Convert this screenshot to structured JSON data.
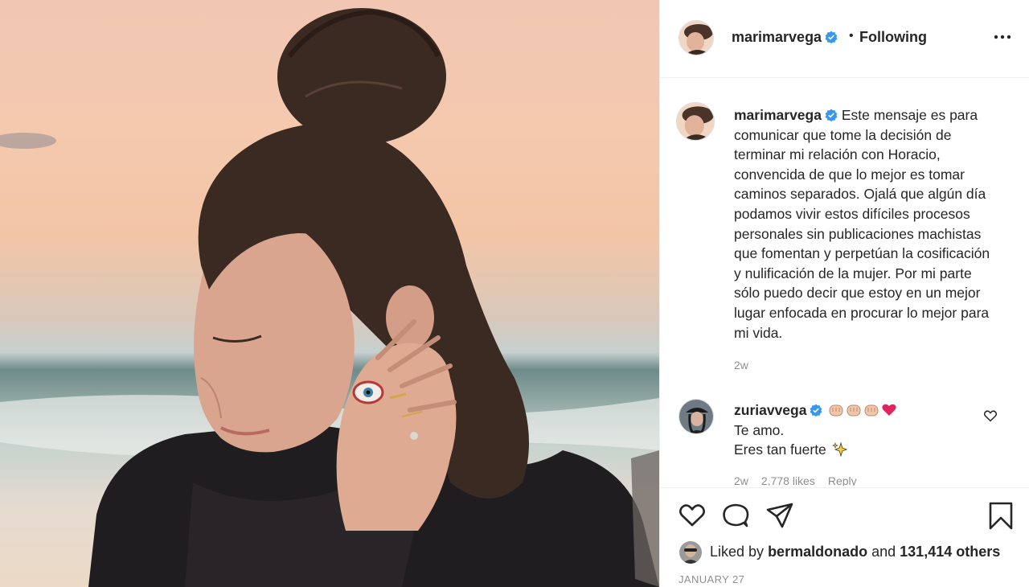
{
  "header": {
    "username": "marimarvega",
    "separator": "•",
    "follow_status": "Following"
  },
  "caption": {
    "username": "marimarvega",
    "text": "Este mensaje es para comunicar que tome la decisión de terminar mi relación con Horacio, convencida de que lo mejor es tomar caminos separados. Ojalá que algún día podamos vivir estos difíciles procesos personales sin publicaciones machistas que fomentan y perpetúan la cosificación y nulificación de la mujer. Por mi parte sólo puedo decir que estoy en un mejor lugar enfocada en procurar lo mejor para mi vida.",
    "time": "2w"
  },
  "comment": {
    "username": "zuriavvega",
    "line1": "Te amo.",
    "line2": "Eres tan fuerte",
    "time": "2w",
    "likes": "2,778 likes",
    "reply": "Reply"
  },
  "likes": {
    "prefix": "Liked by",
    "user": "bermaldonado",
    "mid": "and",
    "count": "131,414 others"
  },
  "date": "JANUARY 27",
  "icons": [
    "verified-badge",
    "more-icon",
    "heart-icon",
    "comment-icon",
    "share-icon",
    "bookmark-icon"
  ],
  "colors": {
    "verified": "#3897f0",
    "heart_emoji": "#e0245e",
    "muted": "#8e8e8e",
    "text": "#262626"
  }
}
